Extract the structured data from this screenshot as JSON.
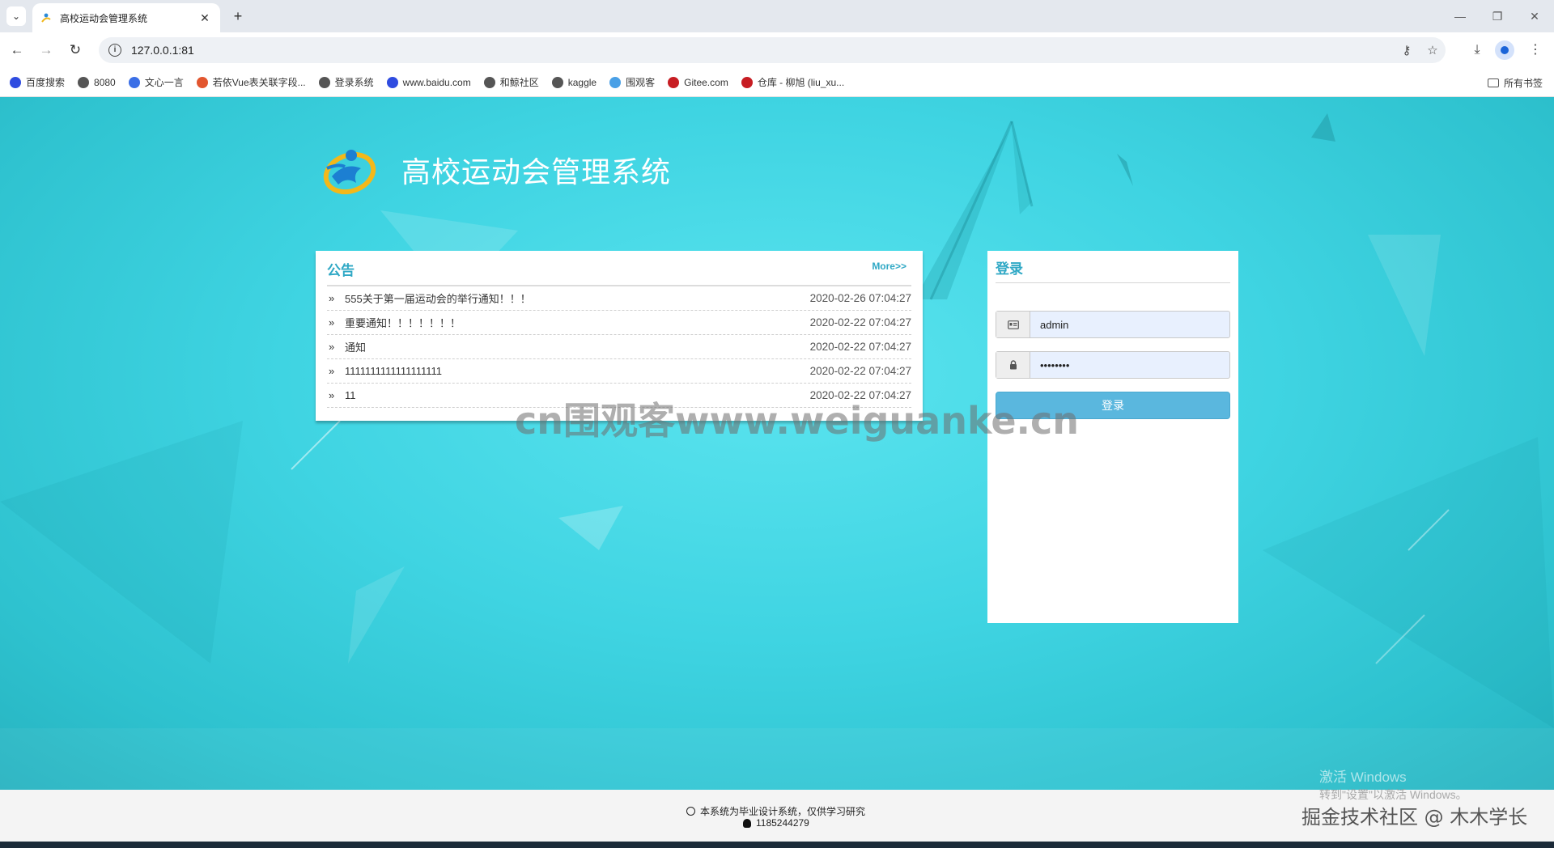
{
  "browser": {
    "tab_title": "高校运动会管理系统",
    "url": "127.0.0.1:81",
    "bookmarks": [
      {
        "label": "百度搜索",
        "icon": "baidu-icon",
        "color": "#2f4ce0"
      },
      {
        "label": "8080",
        "icon": "globe-icon",
        "color": "#555555"
      },
      {
        "label": "文心一言",
        "icon": "wenxin-icon",
        "color": "#3b6fe6"
      },
      {
        "label": "若依Vue表关联字段...",
        "icon": "ruoyi-icon",
        "color": "#e2562f"
      },
      {
        "label": "登录系统",
        "icon": "globe-icon",
        "color": "#555555"
      },
      {
        "label": "www.baidu.com",
        "icon": "baidu-icon",
        "color": "#2f4ce0"
      },
      {
        "label": "和鲸社区",
        "icon": "globe-icon",
        "color": "#555555"
      },
      {
        "label": "kaggle",
        "icon": "globe-icon",
        "color": "#555555"
      },
      {
        "label": "围观客",
        "icon": "weiguanke-icon",
        "color": "#4aa0e6"
      },
      {
        "label": "Gitee.com",
        "icon": "gitee-icon",
        "color": "#c71d23"
      },
      {
        "label": "仓库 - 柳旭 (liu_xu...",
        "icon": "gitee-icon",
        "color": "#c71d23"
      }
    ],
    "all_bookmarks": "所有书签"
  },
  "site": {
    "title": "高校运动会管理系统"
  },
  "notice": {
    "title": "公告",
    "more": "More>>",
    "items": [
      {
        "title": "555关于第一届运动会的举行通知！！！",
        "date": "2020-02-26 07:04:27"
      },
      {
        "title": "重要通知！！！！！！！",
        "date": "2020-02-22 07:04:27"
      },
      {
        "title": "通知",
        "date": "2020-02-22 07:04:27"
      },
      {
        "title": "1111111111111111111",
        "date": "2020-02-22 07:04:27"
      },
      {
        "title": "11",
        "date": "2020-02-22 07:04:27"
      }
    ]
  },
  "login": {
    "title": "登录",
    "username": "admin",
    "password": "••••••••",
    "button": "登录"
  },
  "watermark": "cn围观客www.weiguanke.cn",
  "footer": {
    "line1": "本系统为毕业设计系统，仅供学习研究",
    "qq": "1185244279"
  },
  "overlay": {
    "activate": "激活 Windows",
    "activate_sub": "转到\"设置\"以激活 Windows。",
    "juejin": "掘金技术社区 @ 木木学长"
  },
  "colors": {
    "accent": "#2fa8c5",
    "button": "#5ab7de",
    "background": "#3fd4e2"
  }
}
